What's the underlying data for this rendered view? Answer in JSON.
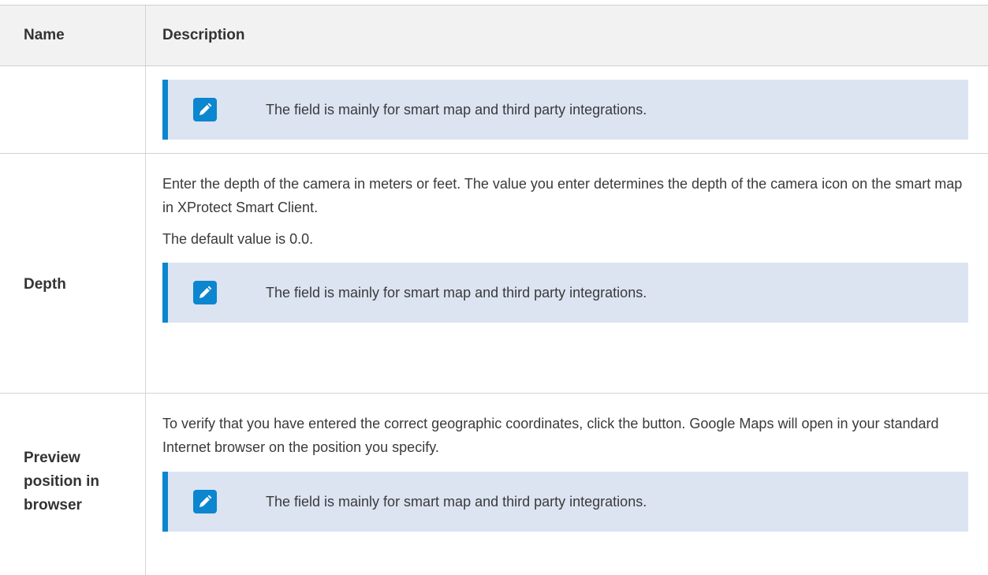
{
  "table": {
    "headers": {
      "name": "Name",
      "description": "Description"
    },
    "rows": [
      {
        "name": "",
        "paragraphs": [],
        "note": "The field is mainly for smart map and third party integrations."
      },
      {
        "name": "Depth",
        "paragraphs": [
          "Enter the depth of the camera in meters or feet. The value you enter determines the depth of the camera icon on the smart map in XProtect Smart Client.",
          "The default value is 0.0."
        ],
        "note": "The field is mainly for smart map and third party integrations."
      },
      {
        "name": "Preview position in browser",
        "paragraphs": [
          "To verify that you have entered the correct geographic coordinates, click the button. Google Maps will open in your standard Internet browser on the position you specify."
        ],
        "note": "The field is mainly for smart map and third party integrations."
      }
    ]
  },
  "icons": {
    "note": "pencil-note-icon"
  },
  "colors": {
    "accent": "#0b86cf",
    "note_background": "#dce4f2",
    "header_background": "#f2f2f2"
  }
}
